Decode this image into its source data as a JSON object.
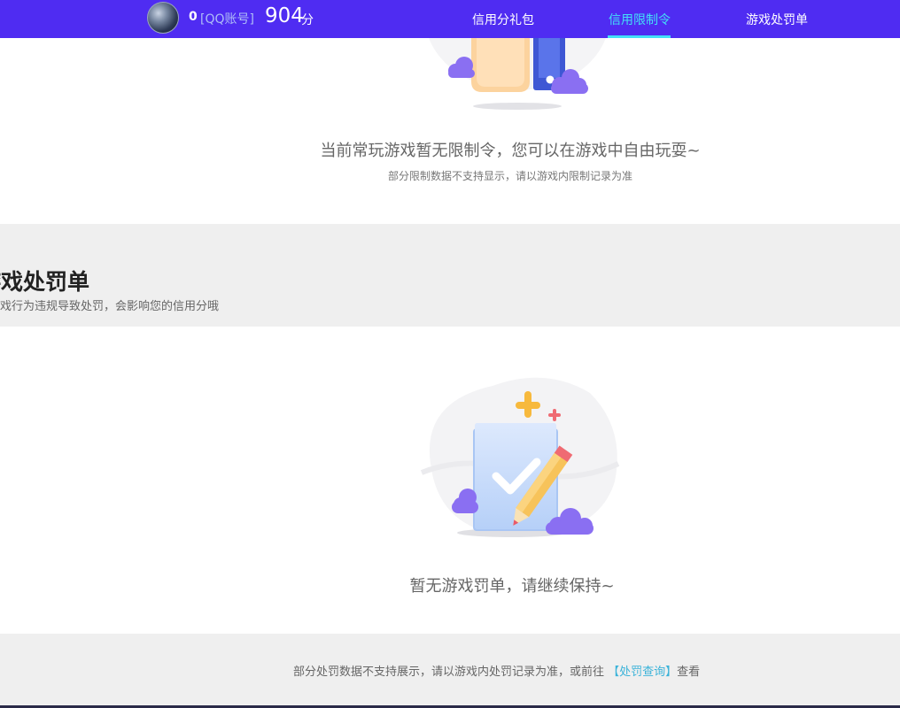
{
  "header": {
    "qq_number": "0",
    "qq_tag": "[QQ账号]",
    "score_value": "904",
    "score_unit": "分",
    "nav": [
      {
        "label": "信用分礼包",
        "active": false
      },
      {
        "label": "信用限制令",
        "active": true
      },
      {
        "label": "游戏处罚单",
        "active": false
      }
    ],
    "colors": {
      "bar": "#4f2cf2",
      "accent": "#43e0f7"
    }
  },
  "restriction": {
    "message": "当前常玩游戏暂无限制令，您可以在游戏中自由玩耍~",
    "note": "部分限制数据不支持显示，请以游戏内限制记录为准"
  },
  "penalty_section": {
    "title": "游戏处罚单",
    "subtitle": "游戏行为违规导致处罚，会影响您的信用分哦",
    "empty_message": "暂无游戏罚单，请继续保持~"
  },
  "footer": {
    "note_prefix": "部分处罚数据不支持展示，请以游戏内处罚记录为准，或前往",
    "link_label": "【处罚查询】",
    "note_suffix": "查看"
  }
}
